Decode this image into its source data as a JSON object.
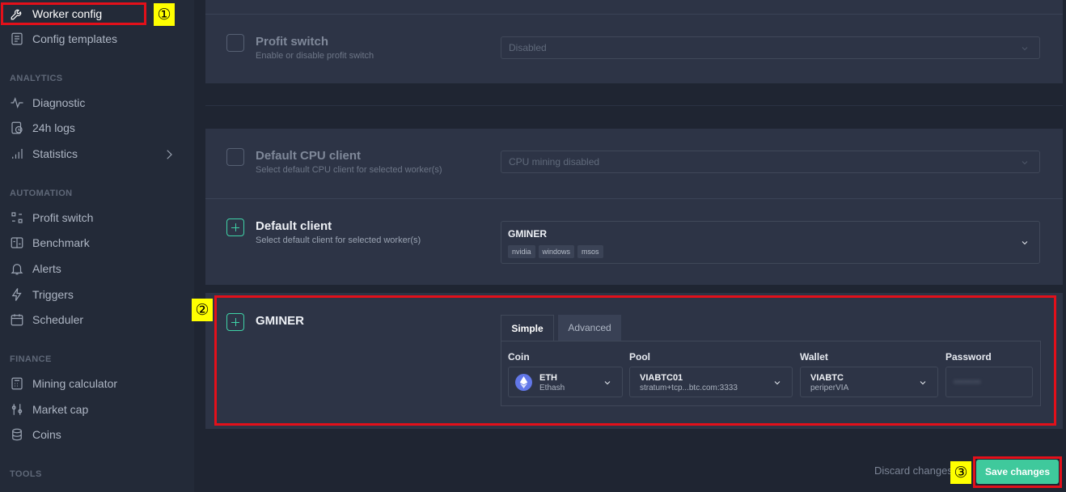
{
  "sidebar": {
    "worker_config": "Worker config",
    "config_templates": "Config templates",
    "section_analytics": "ANALYTICS",
    "diagnostic": "Diagnostic",
    "logs": "24h logs",
    "statistics": "Statistics",
    "section_automation": "AUTOMATION",
    "profit_switch": "Profit switch",
    "benchmark": "Benchmark",
    "alerts": "Alerts",
    "triggers": "Triggers",
    "scheduler": "Scheduler",
    "section_finance": "FINANCE",
    "mining_calculator": "Mining calculator",
    "market_cap": "Market cap",
    "coins": "Coins",
    "section_tools": "TOOLS"
  },
  "annotations": {
    "one": "①",
    "two": "②",
    "three": "③"
  },
  "profit_switch": {
    "title": "Profit switch",
    "subtitle": "Enable or disable profit switch",
    "value": "Disabled"
  },
  "cpu_client": {
    "title": "Default CPU client",
    "subtitle": "Select default CPU client for selected worker(s)",
    "value": "CPU mining disabled"
  },
  "default_client": {
    "title": "Default client",
    "subtitle": "Select default client for selected worker(s)",
    "value": "GMINER",
    "tags": [
      "nvidia",
      "windows",
      "msos"
    ]
  },
  "gminer": {
    "title": "GMINER",
    "tabs": [
      "Simple",
      "Advanced"
    ],
    "coin_label": "Coin",
    "coin_value": "ETH",
    "coin_algo": "Ethash",
    "pool_label": "Pool",
    "pool_value": "VIABTC01",
    "pool_url": "stratum+tcp...btc.com:3333",
    "wallet_label": "Wallet",
    "wallet_value": "VIABTC",
    "wallet_sub": "periperVIA",
    "password_label": "Password",
    "password_value": "••••••••"
  },
  "footer": {
    "discard": "Discard changes",
    "save": "Save changes"
  },
  "colors": {
    "accent": "#3fc99c",
    "highlight": "#e3101a",
    "badge": "#ffff00"
  }
}
